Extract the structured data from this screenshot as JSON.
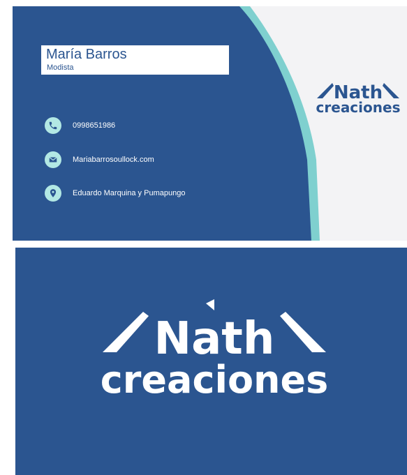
{
  "colors": {
    "card_blue": "#2b5590",
    "accent_teal": "#7fd0cf",
    "icon_bg": "#b2e8e4",
    "light_panel": "#f3f3f5",
    "white": "#ffffff"
  },
  "front": {
    "name": "María Barros",
    "role": "Modista",
    "contacts": [
      {
        "icon": "phone-icon",
        "text": "0998651986"
      },
      {
        "icon": "mail-icon",
        "text": "Mariabarrosoullock.com"
      },
      {
        "icon": "location-icon",
        "text": "Eduardo Marquina y Pumapungo"
      }
    ]
  },
  "logo": {
    "line1": "Nath",
    "line2": "creaciones"
  }
}
